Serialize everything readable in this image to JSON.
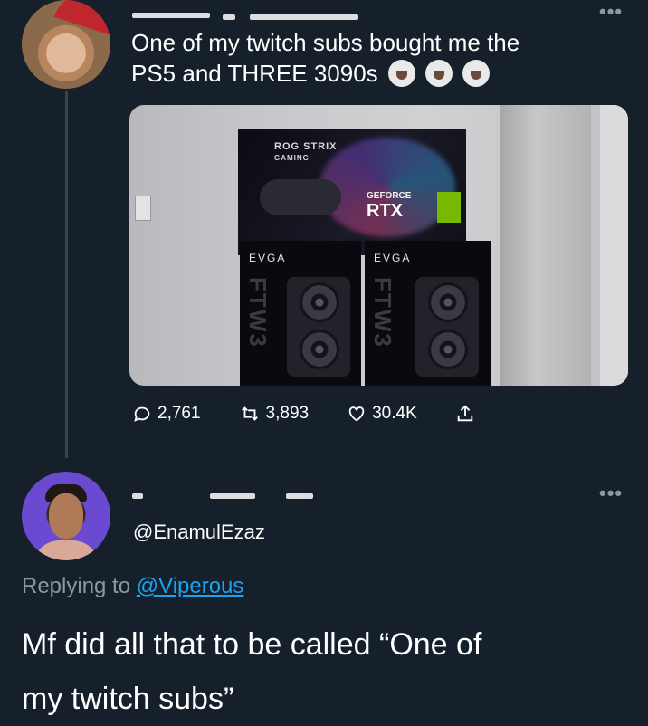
{
  "tweet": {
    "text_line1": "One of my twitch subs bought me the",
    "text_line2": "PS5 and THREE 3090s",
    "emojis": [
      "loudly-crying-face-icon",
      "loudly-crying-face-icon",
      "loudly-crying-face-icon"
    ],
    "photo": {
      "box_rog": "ROG STRIX",
      "box_gaming": "GAMING",
      "box_geforce": "GEFORCE",
      "box_rtx": "RTX",
      "evga_left": "EVGA",
      "evga_right": "EVGA",
      "ftw3": "FTW3"
    },
    "actions": {
      "replies": "2,761",
      "retweets": "3,893",
      "likes": "30.4K"
    }
  },
  "reply": {
    "handle": "@EnamulEzaz",
    "replying_prefix": "Replying to",
    "replying_to": "@Viperous",
    "text_line1": "Mf did all that to be called “One of",
    "text_line2": "my twitch subs”"
  },
  "colors": {
    "background": "#15202b",
    "text": "#ffffff",
    "muted": "#8899a6",
    "link": "#1da1f2"
  }
}
